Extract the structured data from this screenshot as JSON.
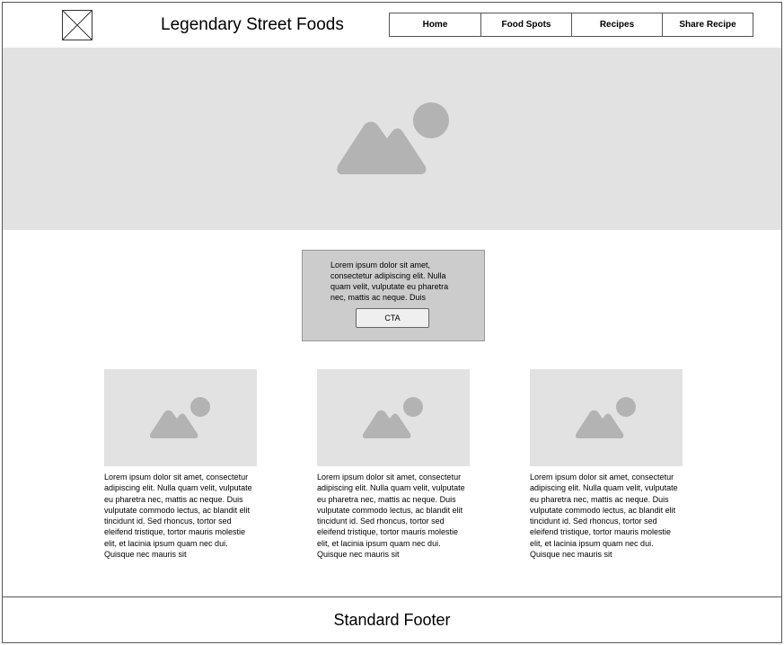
{
  "header": {
    "site_title": "Legendary Street Foods",
    "logo_icon": "image-placeholder-x-icon",
    "nav": [
      {
        "label": "Home"
      },
      {
        "label": "Food Spots"
      },
      {
        "label": "Recipes"
      },
      {
        "label": "Share Recipe"
      }
    ]
  },
  "hero": {
    "icon": "image-placeholder-icon",
    "background": "#e2e2e2",
    "icon_color": "#b3b3b3"
  },
  "cta": {
    "text": "Lorem ipsum dolor sit amet, consectetur adipiscing elit. Nulla quam velit, vulputate eu pharetra nec, mattis ac neque. Duis",
    "button_label": "CTA",
    "background": "#cccccc"
  },
  "cards": [
    {
      "icon": "image-placeholder-icon",
      "text": "Lorem ipsum dolor sit amet, consectetur adipiscing elit. Nulla quam velit, vulputate eu pharetra nec, mattis ac neque. Duis vulputate commodo lectus, ac blandit elit tincidunt id. Sed rhoncus, tortor sed eleifend tristique, tortor mauris molestie elit, et lacinia ipsum quam nec dui. Quisque nec mauris sit"
    },
    {
      "icon": "image-placeholder-icon",
      "text": "Lorem ipsum dolor sit amet, consectetur adipiscing elit. Nulla quam velit, vulputate eu pharetra nec, mattis ac neque. Duis vulputate commodo lectus, ac blandit elit tincidunt id. Sed rhoncus, tortor sed eleifend tristique, tortor mauris molestie elit, et lacinia ipsum quam nec dui. Quisque nec mauris sit"
    },
    {
      "icon": "image-placeholder-icon",
      "text": "Lorem ipsum dolor sit amet, consectetur adipiscing elit. Nulla quam velit, vulputate eu pharetra nec, mattis ac neque. Duis vulputate commodo lectus, ac blandit elit tincidunt id. Sed rhoncus, tortor sed eleifend tristique, tortor mauris molestie elit, et lacinia ipsum quam nec dui. Quisque nec mauris sit"
    }
  ],
  "footer": {
    "text": "Standard Footer"
  }
}
